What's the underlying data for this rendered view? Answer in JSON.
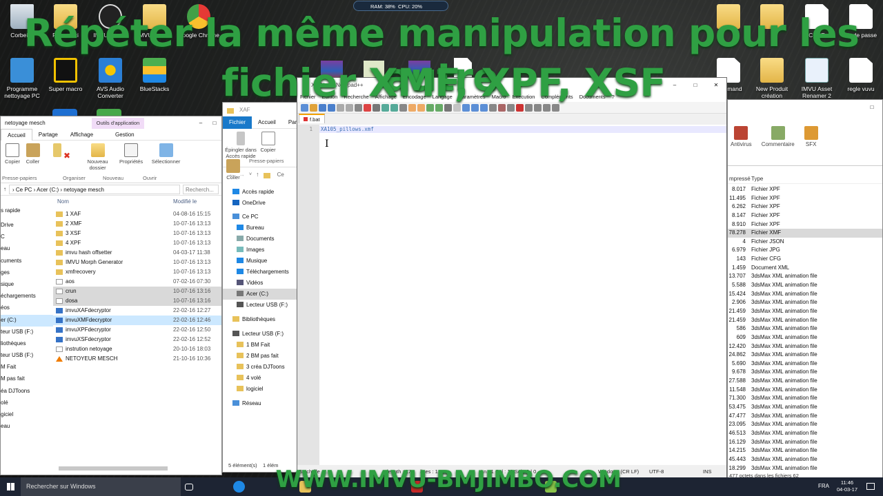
{
  "overlay": {
    "line1": "Répéter la même manipulation pour les autre",
    "line2": "fichier XMF, XPF, XSF",
    "bottom": "WWW.IMVU-BMJIMBO.COM"
  },
  "system_monitor": {
    "ram": "RAM: 38%",
    "cpu": "CPU: 20%"
  },
  "desktop_left": [
    {
      "label": "Corbeille",
      "icon": "recycle-bin-icon",
      "color": "#c9d4de"
    },
    {
      "label": "Programme nettoyage PC",
      "icon": "program-icon",
      "color": "#3a8fd8"
    },
    {
      "label": "Super macro",
      "icon": "macro-icon",
      "color": "#f2c200"
    },
    {
      "label": "AVS Audio Converter",
      "icon": "audio-converter-icon",
      "color": "#2b7fd6"
    },
    {
      "label": "BlueStacks",
      "icon": "bluestacks-icon",
      "color": "#4caf50"
    },
    {
      "label": "Google Chrome",
      "icon": "chrome-icon",
      "color": "#e53935"
    }
  ],
  "desktop_partial_top": [
    "Raccourci",
    "IMVUCreator",
    "IMVUCreator",
    "Google Chrome"
  ],
  "desktop_right": [
    {
      "label": "CKNE",
      "icon": "folder-icon"
    },
    {
      "label": "mode passe",
      "icon": "document-icon"
    },
    {
      "label": "Command",
      "icon": "document-icon"
    },
    {
      "label": "New Produit création",
      "icon": "folder-icon"
    },
    {
      "label": "IMVU Asset Renamer 2",
      "icon": "document-icon"
    },
    {
      "label": "regle vuvu",
      "icon": "document-icon"
    }
  ],
  "explorer1": {
    "title": "netoyage mesch",
    "ctx_tab": "Outils d'application",
    "tabs": [
      "Accueil",
      "Partage",
      "Affichage",
      "Gestion"
    ],
    "ribbon": {
      "copier": "Copier",
      "coller": "Coller",
      "nouveau_dossier": "Nouveau dossier",
      "proprietes": "Propriétés",
      "selectionner": "Sélectionner",
      "groups": [
        "Presse-papiers",
        "Organiser",
        "Nouveau",
        "Ouvrir"
      ]
    },
    "path": [
      "Ce PC",
      "Acer (C:)",
      "netoyage mesch"
    ],
    "search_placeholder": "Recherch...",
    "columns": {
      "name": "Nom",
      "date": "Modifié le"
    },
    "nav": [
      "s rapide",
      "Drive",
      "C",
      "eau",
      "cuments",
      "ges",
      "sique",
      "échargements",
      "éos",
      "er (C:)",
      "teur USB (F:)",
      "liothèques",
      "teur USB (F:)",
      "M Fait",
      "M pas fait",
      "éa DJToons",
      "olé",
      "giciel",
      "eau"
    ],
    "files": [
      {
        "name": "1 XAF",
        "date": "04-08-16 15:15",
        "type": "folder"
      },
      {
        "name": "2 XMF",
        "date": "10-07-16 13:13",
        "type": "folder"
      },
      {
        "name": "3 XSF",
        "date": "10-07-16 13:13",
        "type": "folder"
      },
      {
        "name": "4 XPF",
        "date": "10-07-16 13:13",
        "type": "folder"
      },
      {
        "name": "imvu hash offsetter",
        "date": "04-03-17 11:38",
        "type": "folder"
      },
      {
        "name": "IMVU Morph Generator",
        "date": "10-07-16 13:13",
        "type": "folder"
      },
      {
        "name": "xmfrecovery",
        "date": "10-07-16 13:13",
        "type": "folder"
      },
      {
        "name": "aos",
        "date": "07-02-16 07:30",
        "type": "file"
      },
      {
        "name": "crun",
        "date": "10-07-16 13:16",
        "type": "file"
      },
      {
        "name": "dosa",
        "date": "10-07-16 13:16",
        "type": "file"
      },
      {
        "name": "imvuXAFdecryptor",
        "date": "22-02-16 12:27",
        "type": "exe"
      },
      {
        "name": "imvuXMFdecryptor",
        "date": "22-02-16 12:46",
        "type": "exe"
      },
      {
        "name": "imvuXPFdecryptor",
        "date": "22-02-16 12:50",
        "type": "exe"
      },
      {
        "name": "imvuXSFdecryptor",
        "date": "22-02-16 12:52",
        "type": "exe"
      },
      {
        "name": "instrution netoyage",
        "date": "20-10-16 18:03",
        "type": "file"
      },
      {
        "name": "NETOYEUR MESCH",
        "date": "21-10-16 10:36",
        "type": "vlc"
      }
    ]
  },
  "explorer2": {
    "title": "XAF",
    "tabs": [
      "Fichier",
      "Accueil",
      "Parta"
    ],
    "ribbon": {
      "epingler": "Épingler dans Accès rapide",
      "copier": "Copier",
      "coller": "Coller",
      "group": "Presse-papiers"
    },
    "nav": [
      {
        "label": "Accès rapide",
        "icon": "star-icon"
      },
      {
        "label": "OneDrive",
        "icon": "cloud-icon"
      },
      {
        "label": "Ce PC",
        "icon": "pc-icon"
      },
      {
        "label": "Bureau",
        "icon": "desktop-icon"
      },
      {
        "label": "Documents",
        "icon": "documents-icon"
      },
      {
        "label": "Images",
        "icon": "images-icon"
      },
      {
        "label": "Musique",
        "icon": "music-icon"
      },
      {
        "label": "Téléchargements",
        "icon": "download-icon"
      },
      {
        "label": "Vidéos",
        "icon": "video-icon"
      },
      {
        "label": "Acer (C:)",
        "icon": "drive-icon"
      },
      {
        "label": "Lecteur USB (F:)",
        "icon": "usb-icon"
      },
      {
        "label": "Bibliothèques",
        "icon": "library-icon"
      },
      {
        "label": "Lecteur USB (F:)",
        "icon": "usb-icon"
      },
      {
        "label": "1 BM Fait",
        "icon": "folder-icon"
      },
      {
        "label": "2 BM pas fait",
        "icon": "folder-icon"
      },
      {
        "label": "3 créa DJToons",
        "icon": "folder-icon"
      },
      {
        "label": "4 volé",
        "icon": "folder-icon"
      },
      {
        "label": "logiciel",
        "icon": "folder-icon"
      },
      {
        "label": "Réseau",
        "icon": "network-icon"
      }
    ],
    "path_partial": "Ce",
    "status_items": "5 élément(s)",
    "status_sel": "1 élém"
  },
  "notepad": {
    "title": "XAF\\bat - Notepad++",
    "menu": [
      "Fichier",
      "Edition",
      "Recherche",
      "Affichage",
      "Encodage",
      "Langage",
      "Paramètres",
      "Macro",
      "Exécution",
      "Compléments",
      "Documents",
      "?"
    ],
    "tab": "f.bat",
    "line_no": "1",
    "code": "XA105_pillows.xmf",
    "status": {
      "type": "Batch file",
      "length": "length : 17",
      "lines": "lines : 1",
      "pos": "Ln : 1  Col : 18  Sel : 0 | 0",
      "eol": "Windows (CR LF)",
      "enc": "UTF-8",
      "ins": "INS"
    }
  },
  "explorer3": {
    "ribbon_items": [
      {
        "label": "Antivirus",
        "icon": "antivirus-icon"
      },
      {
        "label": "Commentaire",
        "icon": "comment-icon"
      },
      {
        "label": "SFX",
        "icon": "sfx-icon"
      }
    ],
    "columns": {
      "size": "mpressé",
      "type": "Type"
    },
    "rows": [
      {
        "size": "8.017",
        "type": "Fichier XPF"
      },
      {
        "size": "11.495",
        "type": "Fichier XPF"
      },
      {
        "size": "6.262",
        "type": "Fichier XPF"
      },
      {
        "size": "8.147",
        "type": "Fichier XPF"
      },
      {
        "size": "8.910",
        "type": "Fichier XPF"
      },
      {
        "size": "78.278",
        "type": "Fichier XMF"
      },
      {
        "size": "4",
        "type": "Fichier JSON"
      },
      {
        "size": "6.979",
        "type": "Fichier JPG"
      },
      {
        "size": "143",
        "type": "Fichier CFG"
      },
      {
        "size": "1.459",
        "type": "Document XML"
      },
      {
        "size": "13.707",
        "type": "3dsMax XML animation file"
      },
      {
        "size": "5.588",
        "type": "3dsMax XML animation file"
      },
      {
        "size": "15.424",
        "type": "3dsMax XML animation file"
      },
      {
        "size": "2.906",
        "type": "3dsMax XML animation file"
      },
      {
        "size": "21.459",
        "type": "3dsMax XML animation file"
      },
      {
        "size": "21.459",
        "type": "3dsMax XML animation file"
      },
      {
        "size": "586",
        "type": "3dsMax XML animation file"
      },
      {
        "size": "609",
        "type": "3dsMax XML animation file"
      },
      {
        "size": "12.420",
        "type": "3dsMax XML animation file"
      },
      {
        "size": "24.862",
        "type": "3dsMax XML animation file"
      },
      {
        "size": "5.690",
        "type": "3dsMax XML animation file"
      },
      {
        "size": "9.678",
        "type": "3dsMax XML animation file"
      },
      {
        "size": "27.588",
        "type": "3dsMax XML animation file"
      },
      {
        "size": "11.548",
        "type": "3dsMax XML animation file"
      },
      {
        "size": "71.300",
        "type": "3dsMax XML animation file"
      },
      {
        "size": "53.475",
        "type": "3dsMax XML animation file"
      },
      {
        "size": "47.477",
        "type": "3dsMax XML animation file"
      },
      {
        "size": "23.095",
        "type": "3dsMax XML animation file"
      },
      {
        "size": "46.513",
        "type": "3dsMax XML animation file"
      },
      {
        "size": "16.129",
        "type": "3dsMax XML animation file"
      },
      {
        "size": "14.215",
        "type": "3dsMax XML animation file"
      },
      {
        "size": "45.443",
        "type": "3dsMax XML animation file"
      },
      {
        "size": "18.299",
        "type": "3dsMax XML animation file"
      }
    ],
    "status": "477 octets dans les fichiers 62"
  },
  "taskbar": {
    "search": "Rechercher sur Windows",
    "lang": "FRA",
    "time": "11:46",
    "date": "04-03-17"
  }
}
